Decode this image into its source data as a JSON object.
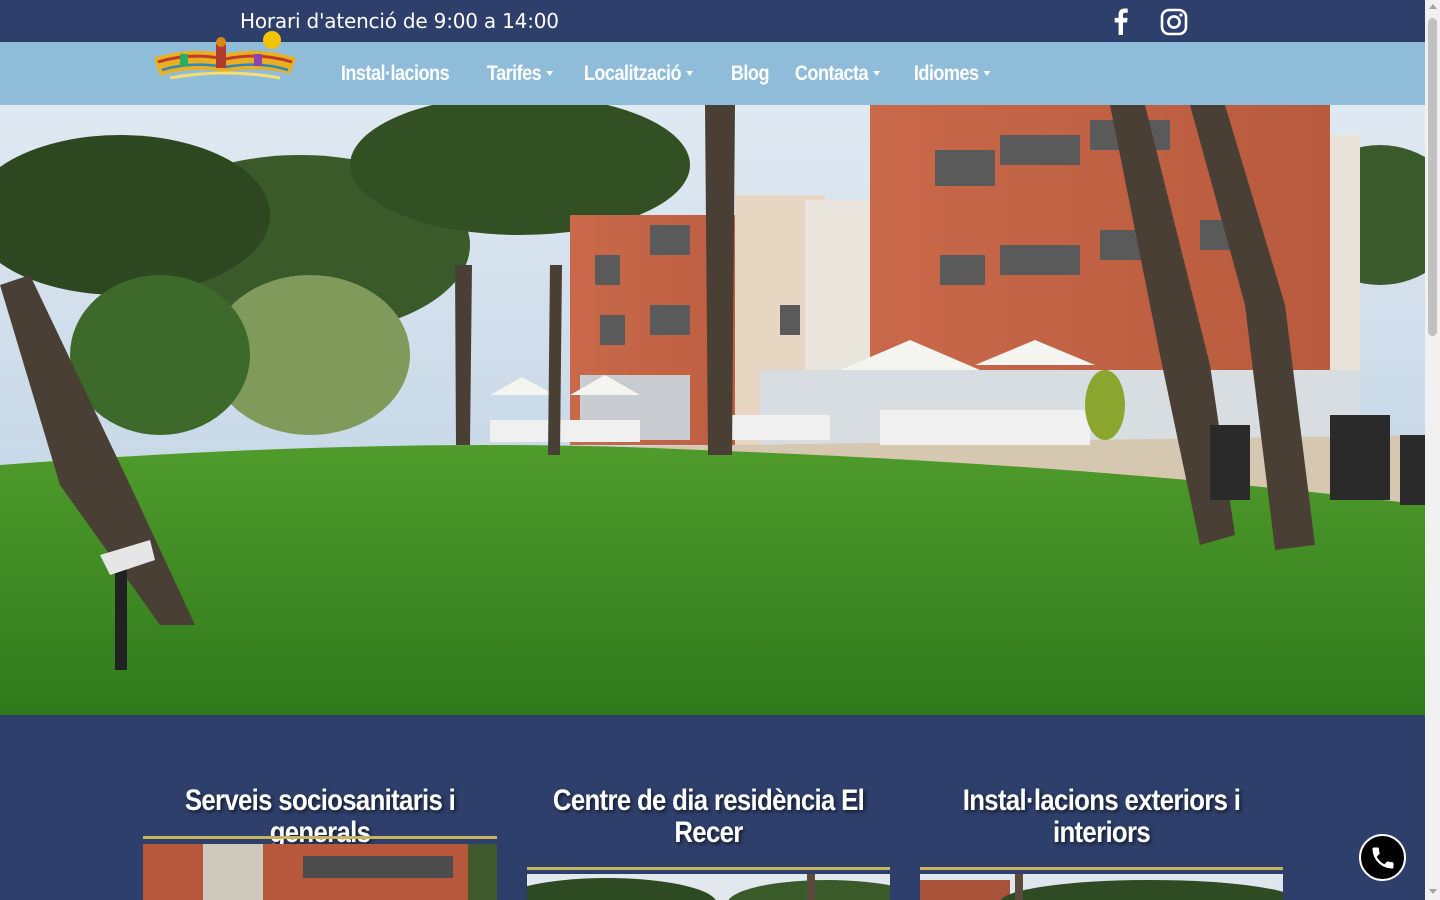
{
  "topbar": {
    "hours": "Horari d'atenció de 9:00 a 14:00",
    "social": [
      {
        "icon": "facebook-icon"
      },
      {
        "icon": "instagram-icon"
      }
    ]
  },
  "nav": {
    "items": [
      {
        "label": "Instal·lacions",
        "dropdown": false
      },
      {
        "label": "Tarifes",
        "dropdown": true
      },
      {
        "label": "Localització",
        "dropdown": true
      },
      {
        "label": "Blog",
        "dropdown": false
      },
      {
        "label": "Contacta",
        "dropdown": true
      },
      {
        "label": "Idiomes",
        "dropdown": true
      }
    ]
  },
  "cards": [
    {
      "title": "Serveis sociosanitaris i generals"
    },
    {
      "title": "Centre de dia residència El Recer"
    },
    {
      "title": "Instal·lacions exteriors i interiors"
    }
  ],
  "colors": {
    "primary": "#2e3f6b",
    "nav_bg": "#8fbcd8",
    "accent_rule": "#c9b45e"
  },
  "call_button": {
    "icon": "phone-icon"
  }
}
